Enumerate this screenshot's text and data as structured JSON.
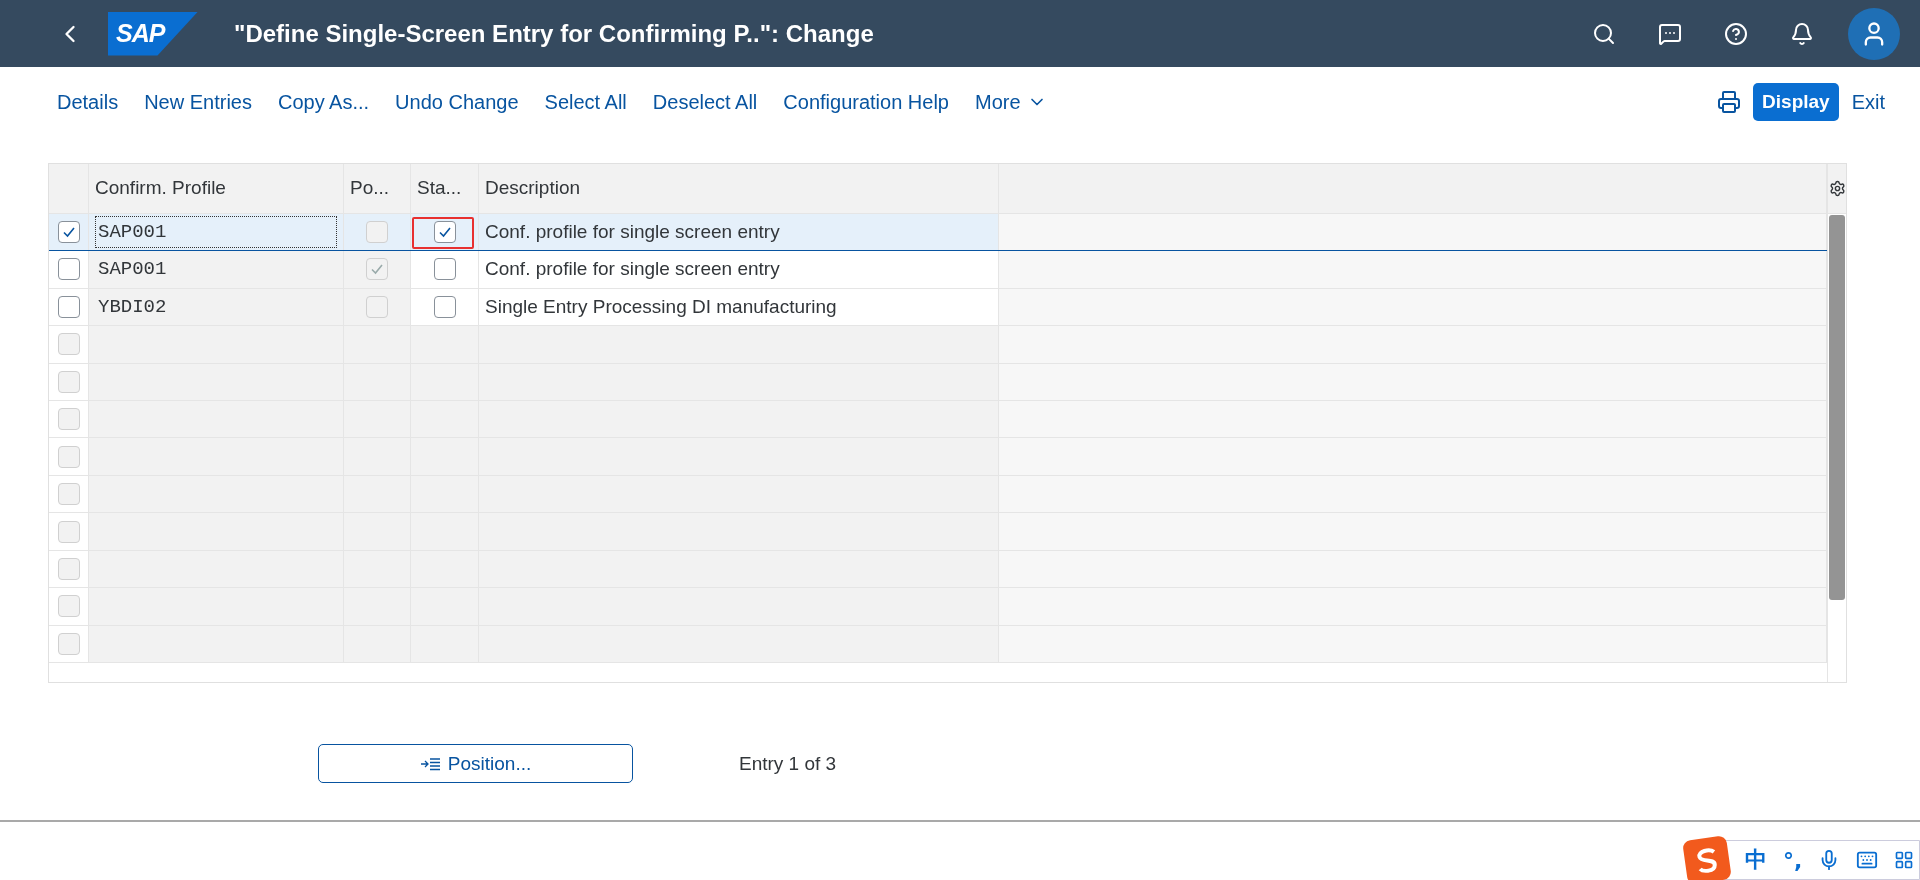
{
  "shell": {
    "logo_text": "SAP",
    "title": "\"Define Single-Screen Entry for Confirming P..\": Change"
  },
  "toolbar": {
    "actions": [
      {
        "label": "Details",
        "kind": "link"
      },
      {
        "label": "New Entries",
        "kind": "link"
      },
      {
        "label": "Copy As...",
        "kind": "link"
      },
      {
        "label": "Undo Change",
        "kind": "link"
      },
      {
        "label": "Select All",
        "kind": "link"
      },
      {
        "label": "Deselect All",
        "kind": "link"
      },
      {
        "label": "Configuration Help",
        "kind": "link"
      },
      {
        "label": "More",
        "kind": "menu"
      }
    ],
    "right": [
      {
        "label": "Display",
        "kind": "primary"
      },
      {
        "label": "Exit",
        "kind": "link"
      }
    ]
  },
  "table": {
    "columns": [
      "Confirm. Profile",
      "Po...",
      "Sta...",
      "Description"
    ],
    "rows": [
      {
        "selected": true,
        "profile": "SAP001",
        "po_checked": false,
        "sta_checked": true,
        "sta_marked": true,
        "description": "Conf. profile for single screen entry"
      },
      {
        "selected": false,
        "profile": "SAP001",
        "po_checked": true,
        "sta_checked": false,
        "sta_marked": false,
        "description": "Conf. profile for single screen entry"
      },
      {
        "selected": false,
        "profile": "YBDI02",
        "po_checked": false,
        "sta_checked": false,
        "sta_marked": false,
        "description": "Single Entry Processing DI manufacturing"
      }
    ],
    "blank_rows": [
      {
        "selected": false
      },
      {
        "selected": false
      },
      {
        "selected": false
      },
      {
        "selected": false
      },
      {
        "selected": false
      },
      {
        "selected": false
      },
      {
        "selected": false
      },
      {
        "selected": false
      },
      {
        "selected": false
      }
    ]
  },
  "position_button": "Position...",
  "entry_info": "Entry 1 of 3",
  "ime_bar": {
    "mode": "中",
    "punct": "°,"
  }
}
